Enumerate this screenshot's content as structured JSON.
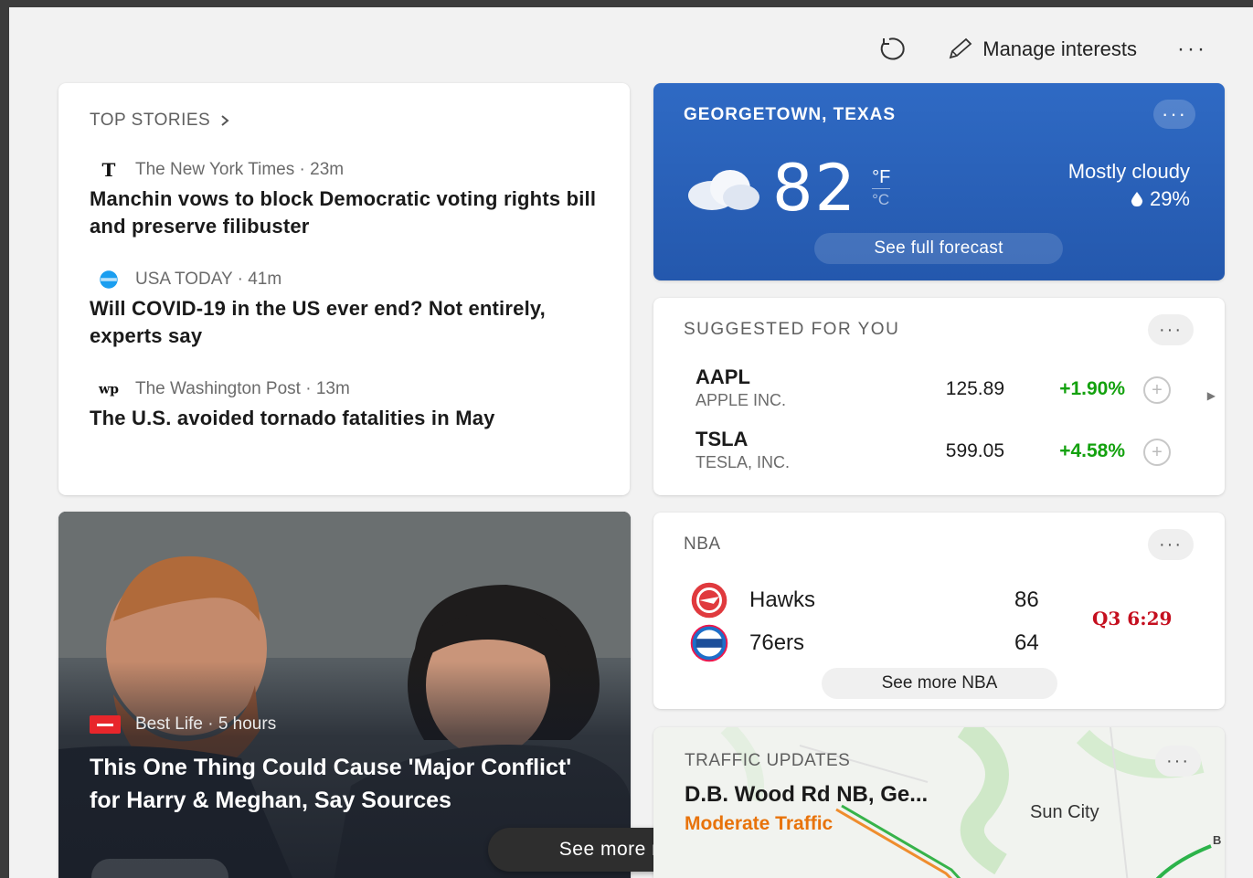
{
  "toolbar": {
    "manage_label": "Manage interests",
    "more_label": "···"
  },
  "top_stories": {
    "title": "TOP STORIES",
    "stories": [
      {
        "source": "The New York Times · 23m",
        "headline": "Manchin vows to block Democratic voting rights bill and preserve filibuster",
        "icon": "nyt-logo-icon"
      },
      {
        "source": "USA TODAY · 41m",
        "headline": "Will COVID-19 in the US ever end? Not entirely, experts say",
        "icon": "usatoday-logo-icon"
      },
      {
        "source": "The Washington Post · 13m",
        "headline": "The U.S. avoided tornado fatalities in May",
        "icon": "wapo-logo-icon"
      }
    ]
  },
  "photo_story": {
    "source": "Best Life · 5 hours",
    "headline": "This One Thing Could Cause 'Major Conflict' for Harry & Meghan, Say Sources"
  },
  "see_more_news": {
    "label": "See more news"
  },
  "weather": {
    "location": "GEORGETOWN, TEXAS",
    "temp": "82",
    "unit_f": "°F",
    "unit_c": "°C",
    "condition": "Mostly cloudy",
    "precip": "29%",
    "forecast_label": "See full forecast",
    "more_label": "···"
  },
  "stocks": {
    "title": "SUGGESTED FOR YOU",
    "more_label": "···",
    "items": [
      {
        "symbol": "AAPL",
        "name": "APPLE INC.",
        "price": "125.89",
        "change": "+1.90%"
      },
      {
        "symbol": "TSLA",
        "name": "TESLA, INC.",
        "price": "599.05",
        "change": "+4.58%"
      }
    ]
  },
  "nba": {
    "title": "NBA",
    "more_label": "···",
    "teams": [
      {
        "name": "Hawks",
        "score": "86"
      },
      {
        "name": "76ers",
        "score": "64"
      }
    ],
    "clock": "Q3 6:29",
    "see_more_label": "See more NBA"
  },
  "traffic": {
    "title": "TRAFFIC UPDATES",
    "road": "D.B. Wood Rd NB, Ge...",
    "status": "Moderate Traffic",
    "city": "Sun City",
    "map_marker": "B",
    "more_label": "···"
  },
  "colors": {
    "weather_bg": "#2c63bd",
    "positive": "#13a10e",
    "live_clock": "#c50f1f",
    "traffic_moderate": "#e8730b"
  }
}
